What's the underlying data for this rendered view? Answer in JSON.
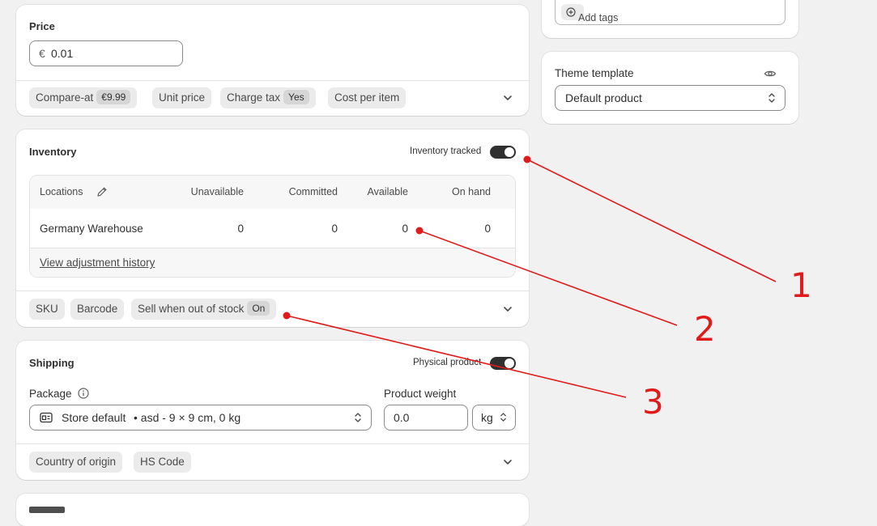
{
  "price": {
    "title": "Price",
    "currency_symbol": "€",
    "value": "0.01",
    "chips": {
      "compare_at_label": "Compare-at",
      "compare_at_value": "€9.99",
      "unit_price_label": "Unit price",
      "charge_tax_label": "Charge tax",
      "charge_tax_value": "Yes",
      "cost_per_item_label": "Cost per item"
    }
  },
  "tags": {
    "add_label": "Add tags"
  },
  "theme": {
    "title": "Theme template",
    "selected": "Default product"
  },
  "inventory": {
    "title": "Inventory",
    "tracked_label": "Inventory tracked",
    "table": {
      "headers": {
        "locations": "Locations",
        "unavailable": "Unavailable",
        "committed": "Committed",
        "available": "Available",
        "on_hand": "On hand"
      },
      "row": {
        "location": "Germany Warehouse",
        "unavailable": "0",
        "committed": "0",
        "available": "0",
        "on_hand": "0"
      },
      "history_link": "View adjustment history"
    },
    "chips": {
      "sku": "SKU",
      "barcode": "Barcode",
      "sell_oos_label": "Sell when out of stock",
      "sell_oos_value": "On"
    }
  },
  "shipping": {
    "title": "Shipping",
    "physical_label": "Physical product",
    "package_label": "Package",
    "package_name": "Store default",
    "package_detail": "• asd - 9 × 9 cm, 0 kg",
    "weight_label": "Product weight",
    "weight_value": "0.0",
    "weight_unit": "kg",
    "chips": {
      "country": "Country of origin",
      "hs_code": "HS Code"
    }
  },
  "annotations": [
    "1",
    "2",
    "3"
  ],
  "colors": {
    "annotation": "#e01b1b",
    "toggle_on": "#303030",
    "chip_bg": "#ebebeb"
  }
}
